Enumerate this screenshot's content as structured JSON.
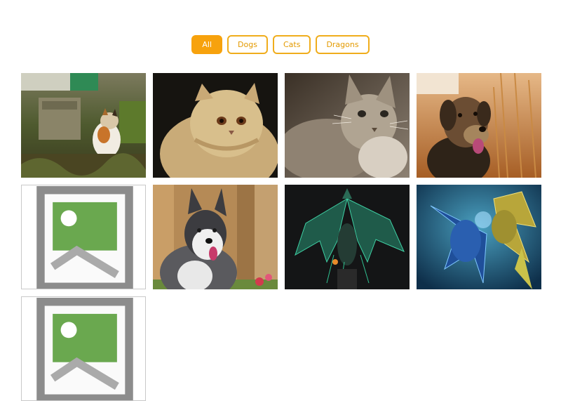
{
  "filters": [
    {
      "label": "All",
      "active": true
    },
    {
      "label": "Dogs",
      "active": false
    },
    {
      "label": "Cats",
      "active": false
    },
    {
      "label": "Dragons",
      "active": false
    }
  ],
  "colors": {
    "accent": "#f7a20d",
    "accent_border": "#f0ad1c"
  },
  "gallery": [
    {
      "subject": "calico-cat-garden",
      "category": "Cats",
      "loaded": true
    },
    {
      "subject": "persian-cat",
      "category": "Cats",
      "loaded": true
    },
    {
      "subject": "tabby-cat-sepia",
      "category": "Cats",
      "loaded": true
    },
    {
      "subject": "terrier-dog-field",
      "category": "Dogs",
      "loaded": true
    },
    {
      "subject": "broken-image",
      "category": "",
      "loaded": false
    },
    {
      "subject": "husky-dog",
      "category": "Dogs",
      "loaded": true
    },
    {
      "subject": "green-dragon",
      "category": "Dragons",
      "loaded": true
    },
    {
      "subject": "blue-dragons",
      "category": "Dragons",
      "loaded": true
    },
    {
      "subject": "broken-image",
      "category": "",
      "loaded": false
    }
  ]
}
